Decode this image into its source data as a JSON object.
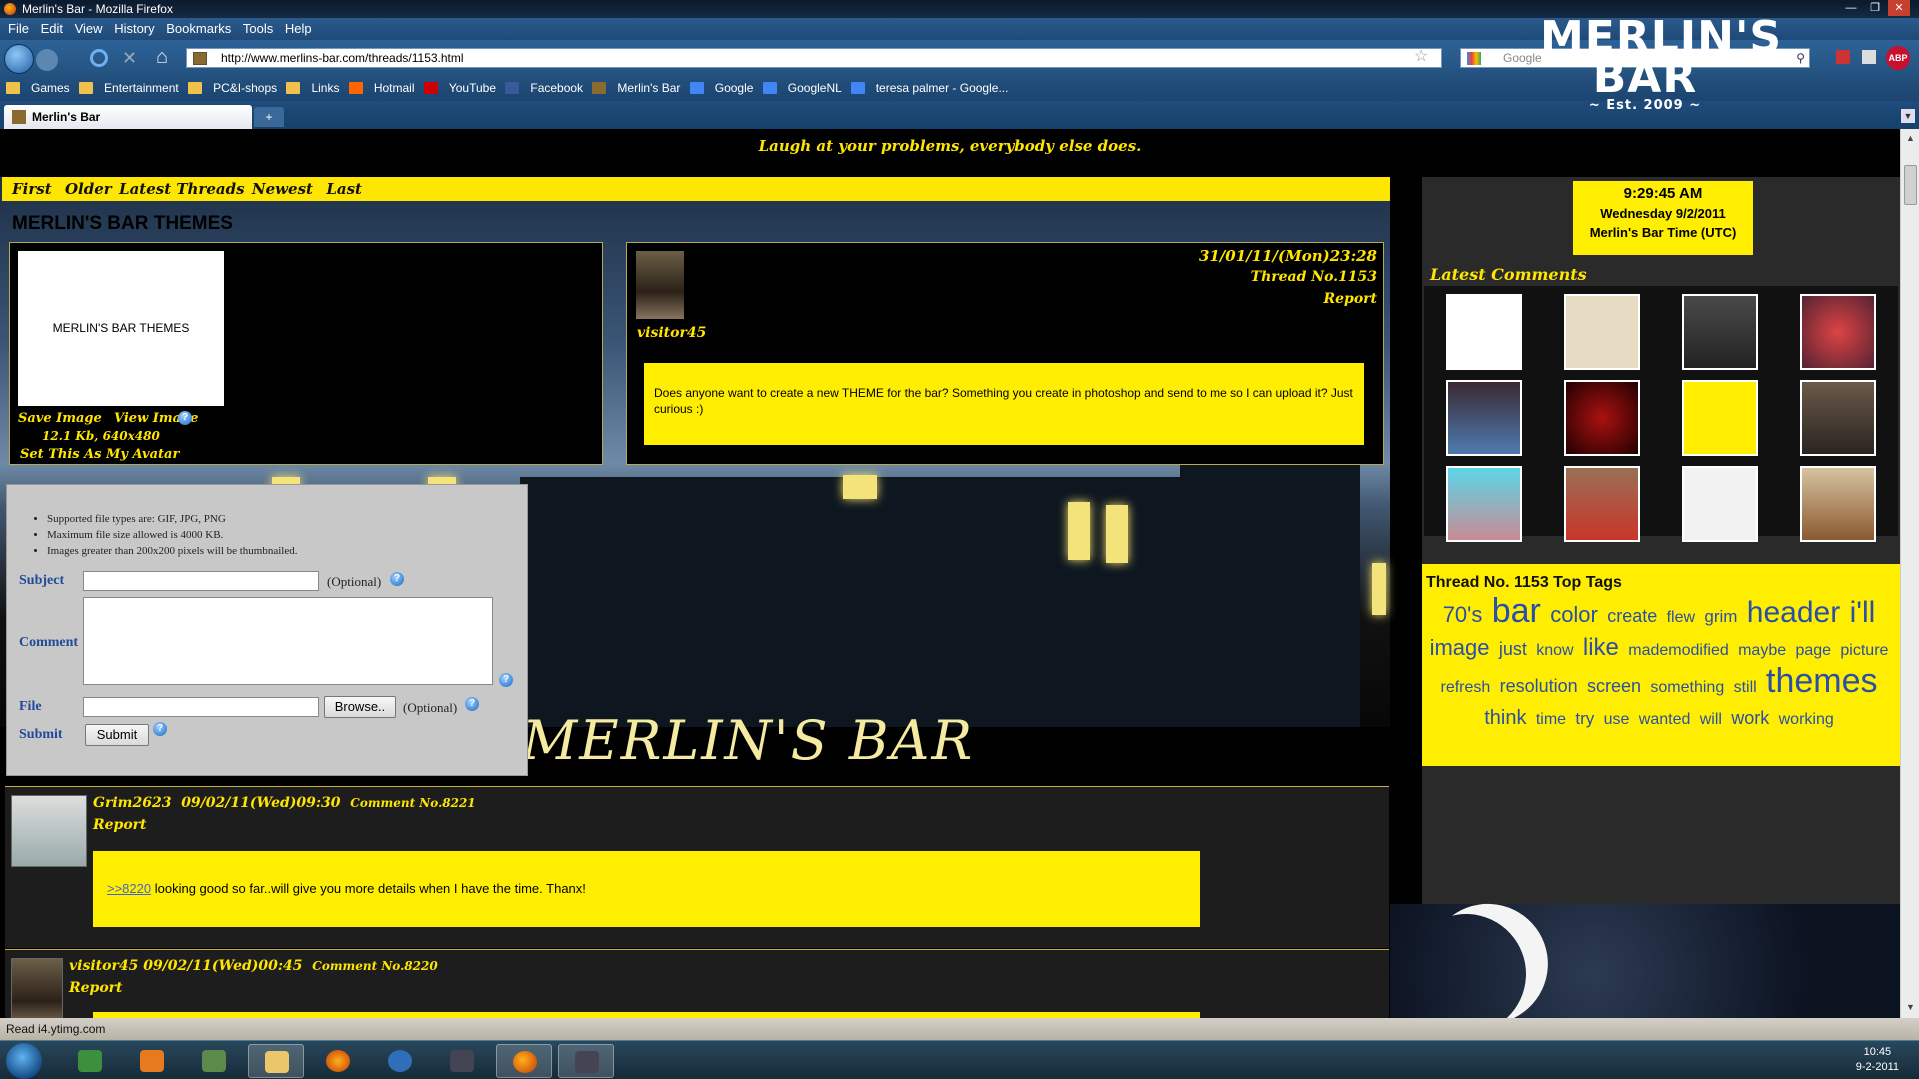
{
  "window": {
    "title": "Merlin's Bar - Mozilla Firefox"
  },
  "menu": [
    "File",
    "Edit",
    "View",
    "History",
    "Bookmarks",
    "Tools",
    "Help"
  ],
  "nav": {
    "url": "http://www.merlins-bar.com/threads/1153.html",
    "search_placeholder": "Google"
  },
  "bookmarks": [
    "Games",
    "Entertainment",
    "PC&I-shops",
    "Links",
    "Hotmail",
    "YouTube",
    "Facebook",
    "Merlin's Bar",
    "Google",
    "GoogleNL",
    "teresa palmer - Google..."
  ],
  "tab": {
    "label": "Merlin's Bar",
    "new": "+"
  },
  "logo": {
    "text": "MERLIN'S BAR",
    "est": "~ Est. 2009 ~"
  },
  "page": {
    "tagline": "Laugh at your problems, everybody else does.",
    "nav_links": [
      "First",
      "Older",
      "Latest Threads",
      "Newest",
      "Last"
    ],
    "thread_title": "MERLIN'S BAR THEMES",
    "image": {
      "thumb_text": "MERLIN'S BAR THEMES",
      "save": "Save Image",
      "view": "View Image",
      "info": "12.1 Kb, 640x480",
      "avatar": "Set This As My Avatar"
    },
    "post": {
      "date": "31/01/11/(Mon)23:28",
      "thread_no": "Thread No.1153",
      "report": "Report",
      "user": "visitor45",
      "body": "Does anyone want to create a new THEME for the bar? Something you create in photoshop and send to me so I can upload it? Just curious :)"
    },
    "scene_sign": "MERLIN'S BAR",
    "form": {
      "rules": [
        "Supported file types are: GIF, JPG, PNG",
        "Maximum file size allowed is 4000 KB.",
        "Images greater than 200x200 pixels will be thumbnailed."
      ],
      "subject_label": "Subject",
      "comment_label": "Comment",
      "file_label": "File",
      "submit_label": "Submit",
      "optional": "(Optional)",
      "browse": "Browse..",
      "submit_button": "Submit"
    },
    "comments": [
      {
        "user": "Grim2623",
        "date": "09/02/11(Wed)09:30",
        "no": "Comment No.8221",
        "report": "Report",
        "quote": ">>8220",
        "body": " looking good so far..will give you more details when I have the time. Thanx!"
      },
      {
        "user": "visitor45",
        "date": "09/02/11(Wed)00:45",
        "no": "Comment No.8220",
        "report": "Report"
      }
    ]
  },
  "sidebar": {
    "clock": {
      "time": "9:29:45 AM",
      "date": "Wednesday 9/2/2011",
      "zone": "Merlin's Bar Time (UTC)"
    },
    "latest_title": "Latest Comments",
    "tags_title": "Thread No. 1153 Top Tags",
    "tags": [
      {
        "t": "70's",
        "s": 22
      },
      {
        "t": "bar",
        "s": 34
      },
      {
        "t": "color",
        "s": 22
      },
      {
        "t": "create",
        "s": 18
      },
      {
        "t": "flew",
        "s": 16
      },
      {
        "t": "grim",
        "s": 17
      },
      {
        "t": "header",
        "s": 30
      },
      {
        "t": "i'll",
        "s": 30
      },
      {
        "t": "image",
        "s": 22
      },
      {
        "t": "just",
        "s": 18
      },
      {
        "t": "know",
        "s": 16
      },
      {
        "t": "like",
        "s": 24
      },
      {
        "t": "mademodified",
        "s": 16
      },
      {
        "t": "maybe",
        "s": 16
      },
      {
        "t": "page",
        "s": 16
      },
      {
        "t": "picture",
        "s": 16
      },
      {
        "t": "refresh",
        "s": 16
      },
      {
        "t": "resolution",
        "s": 18
      },
      {
        "t": "screen",
        "s": 18
      },
      {
        "t": "something",
        "s": 16
      },
      {
        "t": "still",
        "s": 16
      },
      {
        "t": "themes",
        "s": 34
      },
      {
        "t": "think",
        "s": 20
      },
      {
        "t": "time",
        "s": 16
      },
      {
        "t": "try",
        "s": 17
      },
      {
        "t": "use",
        "s": 16
      },
      {
        "t": "wanted",
        "s": 16
      },
      {
        "t": "will",
        "s": 16
      },
      {
        "t": "work",
        "s": 18
      },
      {
        "t": "working",
        "s": 16
      }
    ]
  },
  "status": "Read i4.ytimg.com",
  "tray": {
    "time": "10:45",
    "date": "9-2-2011"
  },
  "colors": {
    "accent_yellow": "#ffee00",
    "chrome_blue": "#24527f",
    "tag_blue": "#2a4fa8"
  }
}
